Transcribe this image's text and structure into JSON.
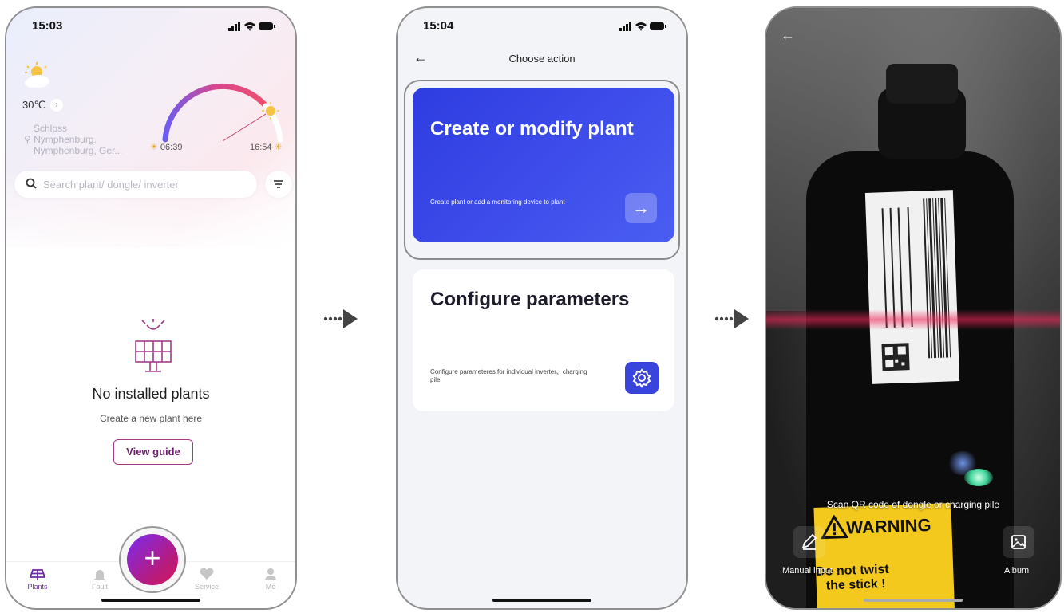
{
  "screen1": {
    "time": "15:03",
    "temperature": "30℃",
    "location_line1": "Schloss",
    "location_line2": "Nymphenburg,",
    "location_line3": "Nymphenburg, Ger...",
    "sunrise": "06:39",
    "sunset": "16:54",
    "search_placeholder": "Search plant/ dongle/ inverter",
    "empty_title": "No installed plants",
    "empty_subtitle": "Create a new plant here",
    "view_guide_label": "View guide",
    "fab_label": "+",
    "tabs": [
      {
        "label": "Plants",
        "icon": "solar-panel-icon",
        "active": true
      },
      {
        "label": "Fault",
        "icon": "alarm-icon",
        "active": false
      },
      {
        "label": "Service",
        "icon": "heart-handshake-icon",
        "active": false
      },
      {
        "label": "Me",
        "icon": "person-icon",
        "active": false
      }
    ],
    "accent_color": "#6b2aa8"
  },
  "screen2": {
    "time": "15:04",
    "title": "Choose action",
    "card1": {
      "title": "Create or modify plant",
      "description": "Create plant or add a monitoring device to plant",
      "arrow_icon": "→"
    },
    "card2": {
      "title": "Configure parameters",
      "description": "Configure parameteres for individual inverter、charging pile"
    },
    "card1_color": "#3340e2"
  },
  "screen3": {
    "scan_hint": "Scan QR code of dongle or charging pile",
    "manual_input_label": "Manual input",
    "album_label": "Album",
    "warning_title": "WARNING",
    "warning_text_line1": "Do not twist",
    "warning_text_line2": "the stick !"
  }
}
